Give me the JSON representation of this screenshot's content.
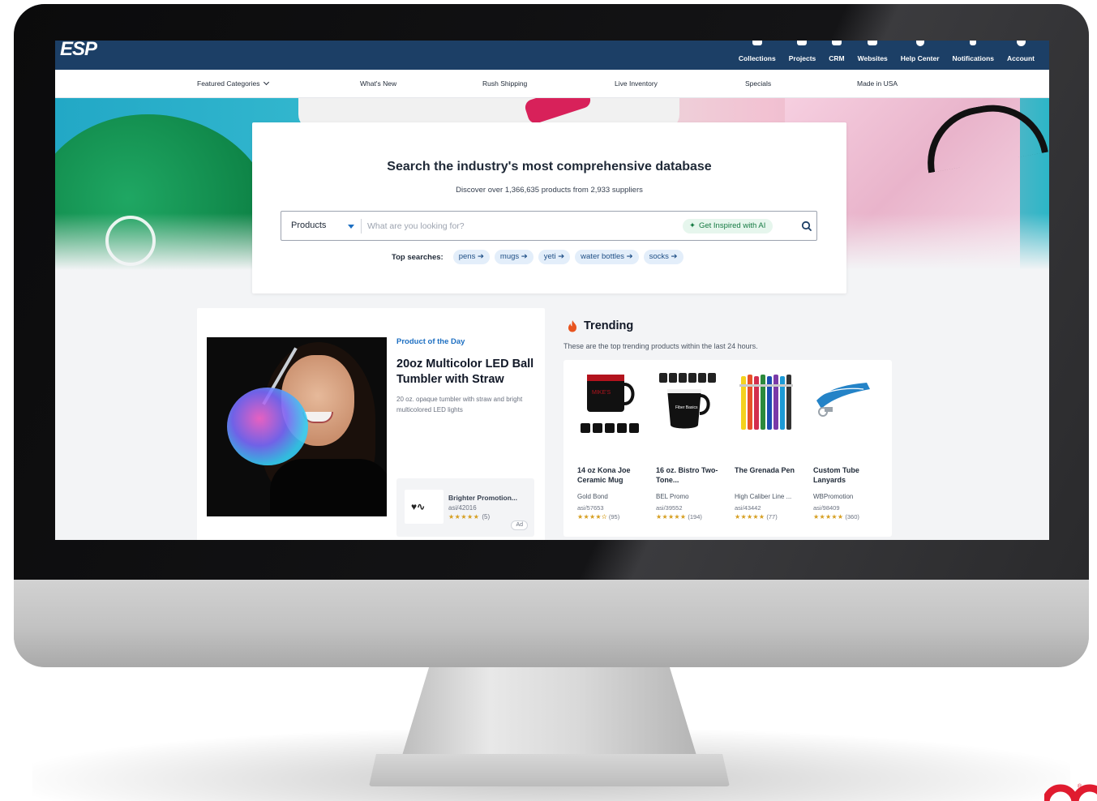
{
  "header": {
    "logo": "ESP",
    "nav": [
      {
        "label": "Collections",
        "icon": "collections-icon"
      },
      {
        "label": "Projects",
        "icon": "projects-icon"
      },
      {
        "label": "CRM",
        "icon": "crm-icon"
      },
      {
        "label": "Websites",
        "icon": "websites-icon"
      },
      {
        "label": "Help Center",
        "icon": "help-icon"
      },
      {
        "label": "Notifications",
        "icon": "bell-icon"
      },
      {
        "label": "Account",
        "icon": "account-icon"
      }
    ]
  },
  "subnav": {
    "items": [
      "Featured Categories",
      "What's New",
      "Rush Shipping",
      "Live Inventory",
      "Specials",
      "Made in USA"
    ]
  },
  "search": {
    "title": "Search the industry's most comprehensive database",
    "subtitle": "Discover over 1,366,635 products from 2,933 suppliers",
    "selector_value": "Products",
    "placeholder": "What are you looking for?",
    "ai_button": "Get Inspired with AI",
    "top_searches_label": "Top searches:",
    "top_searches": [
      "pens ➔",
      "mugs ➔",
      "yeti ➔",
      "water bottles ➔",
      "socks ➔"
    ]
  },
  "product_of_day": {
    "tag": "Product of the Day",
    "title": "20oz Multicolor LED Ball Tumbler with Straw",
    "description": "20 oz. opaque tumbler with straw and bright multicolored LED lights",
    "supplier": {
      "name": "Brighter Promotion...",
      "asi": "asi/42016",
      "stars": "★★★★★",
      "count": "(5)",
      "ad_label": "Ad"
    }
  },
  "trending": {
    "title": "Trending",
    "subtitle": "These are the top trending products within the last 24 hours.",
    "products": [
      {
        "name": "14 oz Kona Joe Ceramic Mug",
        "supplier": "Gold Bond",
        "asi": "asi/57653",
        "stars": "★★★★✫",
        "count": "(95)"
      },
      {
        "name": "16 oz. Bistro Two-Tone...",
        "supplier": "BEL Promo",
        "asi": "asi/39552",
        "stars": "★★★★★",
        "count": "(194)"
      },
      {
        "name": "The Grenada Pen",
        "supplier": "High Caliber Line ...",
        "asi": "asi/43442",
        "stars": "★★★★★",
        "count": "(77)"
      },
      {
        "name": "Custom Tube Lanyards",
        "supplier": "WBPromotion",
        "asi": "asi/98409",
        "stars": "★★★★★",
        "count": "(360)"
      }
    ]
  },
  "colors": {
    "topbar": "#1c3f66",
    "link_blue": "#1d6fc2",
    "ai_green": "#157a42",
    "star_gold": "#d69e1f"
  }
}
